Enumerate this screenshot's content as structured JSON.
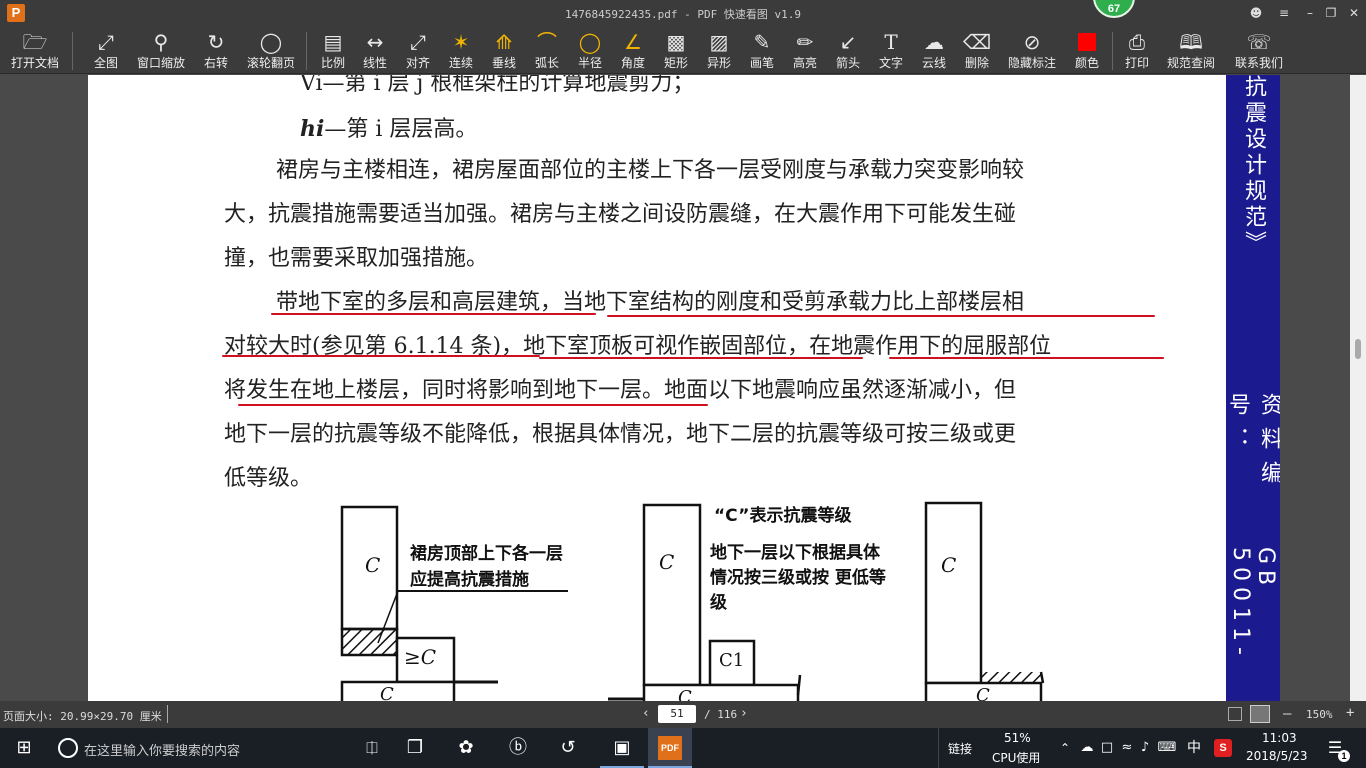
{
  "window": {
    "title": "1476845922435.pdf - PDF 快速看图 v1.9",
    "app_icon": "P",
    "badge": "67"
  },
  "toolbar": [
    {
      "icon": "folder-icon",
      "label": "打开文档"
    },
    {
      "icon": "fit-page-icon",
      "label": "全图"
    },
    {
      "icon": "zoom-window-icon",
      "label": "窗口缩放"
    },
    {
      "icon": "rotate-right-icon",
      "label": "右转"
    },
    {
      "icon": "mouse-wheel-icon",
      "label": "滚轮翻页"
    },
    {
      "icon": "scale-icon",
      "label": "比例"
    },
    {
      "icon": "linear-measure-icon",
      "label": "线性"
    },
    {
      "icon": "aligned-measure-icon",
      "label": "对齐"
    },
    {
      "icon": "continuous-measure-icon",
      "label": "连续"
    },
    {
      "icon": "perpendicular-icon",
      "label": "垂线"
    },
    {
      "icon": "arc-length-icon",
      "label": "弧长"
    },
    {
      "icon": "radius-icon",
      "label": "半径"
    },
    {
      "icon": "angle-icon",
      "label": "角度"
    },
    {
      "icon": "rectangle-icon",
      "label": "矩形"
    },
    {
      "icon": "irregular-shape-icon",
      "label": "异形"
    },
    {
      "icon": "pen-icon",
      "label": "画笔"
    },
    {
      "icon": "highlighter-icon",
      "label": "高亮"
    },
    {
      "icon": "arrow-icon",
      "label": "箭头"
    },
    {
      "icon": "text-icon",
      "label": "文字"
    },
    {
      "icon": "cloud-line-icon",
      "label": "云线"
    },
    {
      "icon": "eraser-icon",
      "label": "删除"
    },
    {
      "icon": "hide-annotation-icon",
      "label": "隐藏标注"
    },
    {
      "icon": "color-swatch-icon",
      "label": "颜色"
    },
    {
      "icon": "printer-icon",
      "label": "打印"
    },
    {
      "icon": "book-search-icon",
      "label": "规范查阅"
    },
    {
      "icon": "contact-icon",
      "label": "联系我们"
    }
  ],
  "accent_color": "#d0101e",
  "swatch_color": "#ff0000",
  "banner": {
    "text1": "抗震设计规范》",
    "text2": "资料编号：",
    "text3": "GB 50011-"
  },
  "document": {
    "line_top": "Vi—第 i 层 j 根框架柱的计算地震剪力；",
    "line_hi_symbol": "hi",
    "line_hi_text": "—第 i 层层高。",
    "p1": [
      "裙房与主楼相连，裙房屋面部位的主楼上下各一层受刚度与承载力突变影响较",
      "大，抗震措施需要适当加强。裙房与主楼之间设防震缝，在大震作用下可能发生碰",
      "撞，也需要采取加强措施。"
    ],
    "p2": [
      "带地下室的多层和高层建筑，当地下室结构的刚度和受剪承载力比上部楼层相",
      "对较大时(参见第 6.1.14 条)，地下室顶板可视作嵌固部位，在地震作用下的屈服部位",
      "将发生在地上楼层，同时将影响到地下一层。地面以下地震响应虽然逐渐减小，但",
      "地下一层的抗震等级不能降低，根据具体情况，地下二层的抗震等级可按三级或更",
      "低等级。"
    ]
  },
  "figure": {
    "note_a_line1": "裙房顶部上下各一层",
    "note_a_line2": "应提高抗震措施",
    "label_c1": "C",
    "label_ge_c": "≥C",
    "label_c_base1": "C",
    "note_b_title": "“C”表示抗震等级",
    "note_b_line1": "地下一层以下根据具体",
    "note_b_line2": "情况按三级或按 更低等",
    "note_b_line3": "级",
    "label_c2": "C",
    "label_c1b": "C1",
    "label_c_base2": "C",
    "label_c3": "C",
    "label_c_base3": "C"
  },
  "status": {
    "page_size": "页面大小: 20.99×29.70 厘米",
    "current_page": "51",
    "total_pages": "/ 116",
    "zoom": "150%"
  },
  "taskbar": {
    "search_placeholder": "在这里输入你要搜索的内容",
    "link_label": "链接",
    "cpu_percent": "51%",
    "cpu_label": "CPU使用",
    "ime": "中",
    "time": "11:03",
    "date": "2018/5/23",
    "notifications": "1",
    "pdf_app_label": "PDF"
  }
}
